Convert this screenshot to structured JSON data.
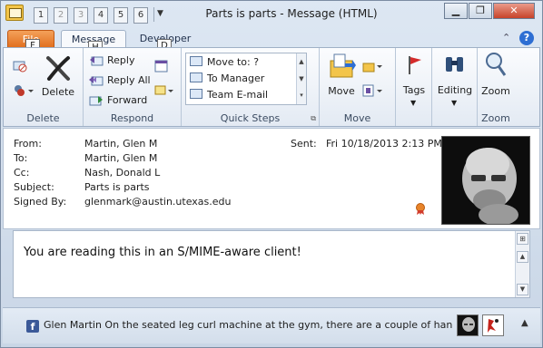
{
  "window": {
    "title": "Parts is parts  -  Message (HTML)"
  },
  "qat": {
    "keytips": [
      "1",
      "2",
      "3",
      "4",
      "5",
      "6"
    ]
  },
  "tabs": {
    "file": "File",
    "message": "Message",
    "developer": "Developer",
    "keytips": {
      "file": "F",
      "message": "H",
      "developer": "D"
    }
  },
  "ribbon": {
    "delete_group": {
      "label": "Delete",
      "delete_button": "Delete"
    },
    "respond_group": {
      "label": "Respond",
      "reply": "Reply",
      "reply_all": "Reply All",
      "forward": "Forward"
    },
    "quick_steps_group": {
      "label": "Quick Steps",
      "items": [
        "Move to: ?",
        "To Manager",
        "Team E-mail"
      ]
    },
    "move_group": {
      "label": "Move",
      "move_button": "Move"
    },
    "tags_group": {
      "tags_button": "Tags"
    },
    "editing_group": {
      "editing_button": "Editing"
    },
    "zoom_group": {
      "label": "Zoom",
      "zoom_button": "Zoom"
    }
  },
  "header": {
    "from_label": "From:",
    "from_value": "Martin, Glen M",
    "to_label": "To:",
    "to_value": "Martin, Glen M",
    "cc_label": "Cc:",
    "cc_value": "Nash, Donald L",
    "subject_label": "Subject:",
    "subject_value": "Parts is parts",
    "signed_label": "Signed By:",
    "signed_value": "glenmark@austin.utexas.edu",
    "sent_label": "Sent:",
    "sent_value": "Fri 10/18/2013 2:13 PM"
  },
  "body": {
    "text": "You are reading this in an S/MIME-aware client!"
  },
  "people_pane": {
    "status_text": "Glen Martin On the seated leg curl machine at the gym, there are a couple of han..."
  },
  "colors": {
    "file_tab": "#e06d1c",
    "accent_blue": "#2d6ed3",
    "facebook": "#3b5998"
  }
}
